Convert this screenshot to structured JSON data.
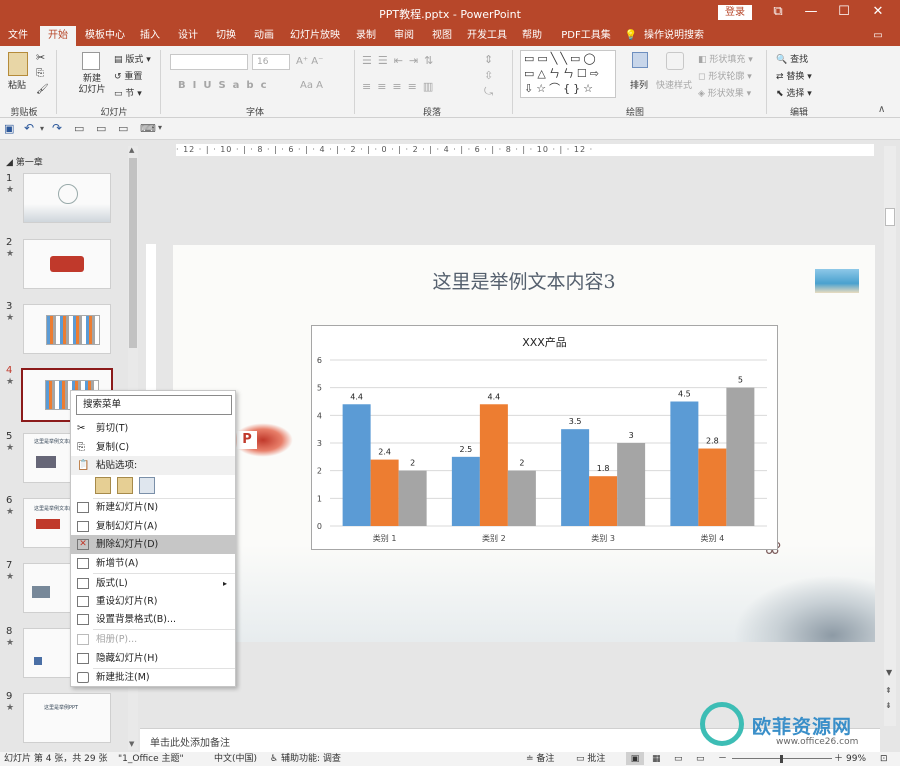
{
  "window": {
    "title": "PPT教程.pptx - PowerPoint",
    "login": "登录"
  },
  "tabs": [
    "文件",
    "开始",
    "模板中心",
    "插入",
    "设计",
    "切换",
    "动画",
    "幻灯片放映",
    "录制",
    "审阅",
    "视图",
    "开发工具",
    "帮助",
    "PDF工具集",
    "操作说明搜索"
  ],
  "active_tab": "开始",
  "ribbon": {
    "paste": "粘贴",
    "clipboard": "剪贴板",
    "new_slide": "新建\n幻灯片",
    "layout": "版式",
    "reset": "重置",
    "section": "节",
    "slides_group": "幻灯片",
    "font_size": "16",
    "font_group": "字体",
    "paragraph_group": "段落",
    "arrange": "排列",
    "quick_styles": "快速样式",
    "shape_fill": "形状填充",
    "shape_outline": "形状轮廓",
    "shape_effects": "形状效果",
    "drawing_group": "绘图",
    "find": "查找",
    "replace": "替换",
    "select": "选择",
    "editing_group": "编辑"
  },
  "thumbs": {
    "section": "第一章",
    "items": [
      {
        "num": "1",
        "star": "★"
      },
      {
        "num": "2",
        "star": "★"
      },
      {
        "num": "3",
        "star": "★"
      },
      {
        "num": "4",
        "star": "★"
      },
      {
        "num": "5",
        "star": "★"
      },
      {
        "num": "6",
        "star": "★"
      },
      {
        "num": "7",
        "star": "★"
      },
      {
        "num": "8",
        "star": "★"
      },
      {
        "num": "9",
        "star": "★"
      }
    ],
    "thumb_texts": [
      "这里是举例文本内容",
      "这里是举例PPT"
    ]
  },
  "ruler": "· 12 · | · 10 · | · 8 · | · 6 · | · 4 · | · 2 · | · 0 · | · 2 · | · 4 · | · 6 · | · 8 · | · 10 · | · 12 ·",
  "slide": {
    "title": "这里是举例文本内容3",
    "logo_text": "P"
  },
  "chart_data": {
    "type": "bar",
    "title": "XXX产品",
    "categories": [
      "类别 1",
      "类别 2",
      "类别 3",
      "类别 4"
    ],
    "series": [
      {
        "values": [
          4.4,
          2.5,
          3.5,
          4.5
        ],
        "color": "#5b9bd5"
      },
      {
        "values": [
          2.4,
          4.4,
          1.8,
          2.8
        ],
        "color": "#ed7d31"
      },
      {
        "values": [
          2,
          2,
          3,
          5
        ],
        "color": "#a5a5a5"
      }
    ],
    "ylim": [
      0,
      6
    ],
    "yticks": [
      "0",
      "1",
      "2",
      "3",
      "4",
      "5",
      "6"
    ],
    "grid": true,
    "data_labels": true
  },
  "context_menu": {
    "search": "搜索菜单",
    "items": [
      {
        "label": "剪切(T)",
        "icon": "scissors-icon"
      },
      {
        "label": "复制(C)",
        "icon": "copy-icon"
      },
      {
        "label": "粘贴选项:",
        "icon": "paste-icon",
        "header": true
      },
      {
        "label": "新建幻灯片(N)",
        "icon": "new-slide-icon"
      },
      {
        "label": "复制幻灯片(A)",
        "icon": "duplicate-slide-icon"
      },
      {
        "label": "删除幻灯片(D)",
        "icon": "delete-slide-icon",
        "highlight": true
      },
      {
        "label": "新增节(A)",
        "icon": "add-section-icon"
      },
      {
        "label": "版式(L)",
        "icon": "layout-icon",
        "submenu": true
      },
      {
        "label": "重设幻灯片(R)",
        "icon": "reset-slide-icon"
      },
      {
        "label": "设置背景格式(B)...",
        "icon": "format-background-icon"
      },
      {
        "label": "相册(P)...",
        "icon": "photo-album-icon",
        "disabled": true
      },
      {
        "label": "隐藏幻灯片(H)",
        "icon": "hide-slide-icon"
      },
      {
        "label": "新建批注(M)",
        "icon": "new-comment-icon"
      }
    ]
  },
  "notes": {
    "placeholder": "单击此处添加备注"
  },
  "status": {
    "slide_info": "幻灯片 第 4 张，共 29 张",
    "theme": "\"1_Office 主题\"",
    "language": "中文(中国)",
    "accessibility": "辅助功能: 调查",
    "notes_btn": "备注",
    "comments_btn": "批注",
    "zoom": "99%"
  },
  "watermark": {
    "brand": "欧菲资源网",
    "url": "www.office26.com"
  }
}
